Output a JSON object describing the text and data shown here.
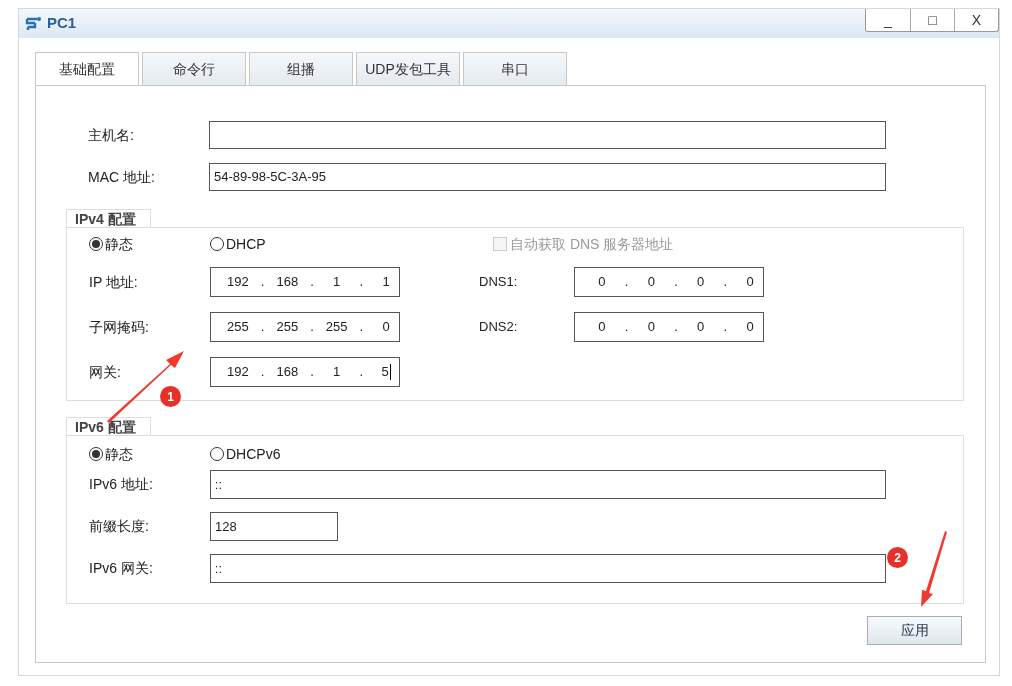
{
  "window": {
    "title": "PC1",
    "controls": [
      "_",
      "□",
      "X"
    ]
  },
  "tabs": [
    {
      "label": "基础配置",
      "selected": true
    },
    {
      "label": "命令行",
      "selected": false
    },
    {
      "label": "组播",
      "selected": false
    },
    {
      "label": "UDP发包工具",
      "selected": false
    },
    {
      "label": "串口",
      "selected": false
    }
  ],
  "host_fields": [
    {
      "label": "主机名:"
    },
    {
      "label": "MAC 地址:",
      "value": "54-89-98-5C-3A-95"
    }
  ],
  "ipv4": {
    "title": "IPv4 配置",
    "modes": [
      {
        "label": "静态",
        "selected": true
      },
      {
        "label": "DHCP",
        "selected": false
      }
    ],
    "auto_dns": {
      "label": "自动获取 DNS 服务器地址",
      "checked": false,
      "disabled": true
    },
    "separator": ".",
    "rows": [
      {
        "label": "IP 地址:",
        "octets": [
          "192",
          "168",
          "1",
          "1"
        ],
        "focused": false,
        "dns_label": "DNS1:",
        "dns_octets": [
          "0",
          "0",
          "0",
          "0"
        ]
      },
      {
        "label": "子网掩码:",
        "octets": [
          "255",
          "255",
          "255",
          "0"
        ],
        "focused": false,
        "dns_label": "DNS2:",
        "dns_octets": [
          "0",
          "0",
          "0",
          "0"
        ]
      },
      {
        "label": "网关:",
        "octets": [
          "192",
          "168",
          "1",
          "5"
        ],
        "focused": true
      }
    ]
  },
  "ipv6": {
    "title": "IPv6 配置",
    "modes": [
      {
        "label": "静态",
        "selected": true
      },
      {
        "label": "DHCPv6",
        "selected": false
      }
    ],
    "fields": [
      {
        "label": "IPv6 地址:",
        "value": "::",
        "kind": "wide"
      },
      {
        "label": "前缀长度:",
        "value": "128",
        "kind": "short"
      },
      {
        "label": "IPv6 网关:",
        "value": "::",
        "kind": "wide"
      }
    ]
  },
  "apply_button": "应用",
  "annotations": [
    {
      "number": "1"
    },
    {
      "number": "2"
    }
  ]
}
